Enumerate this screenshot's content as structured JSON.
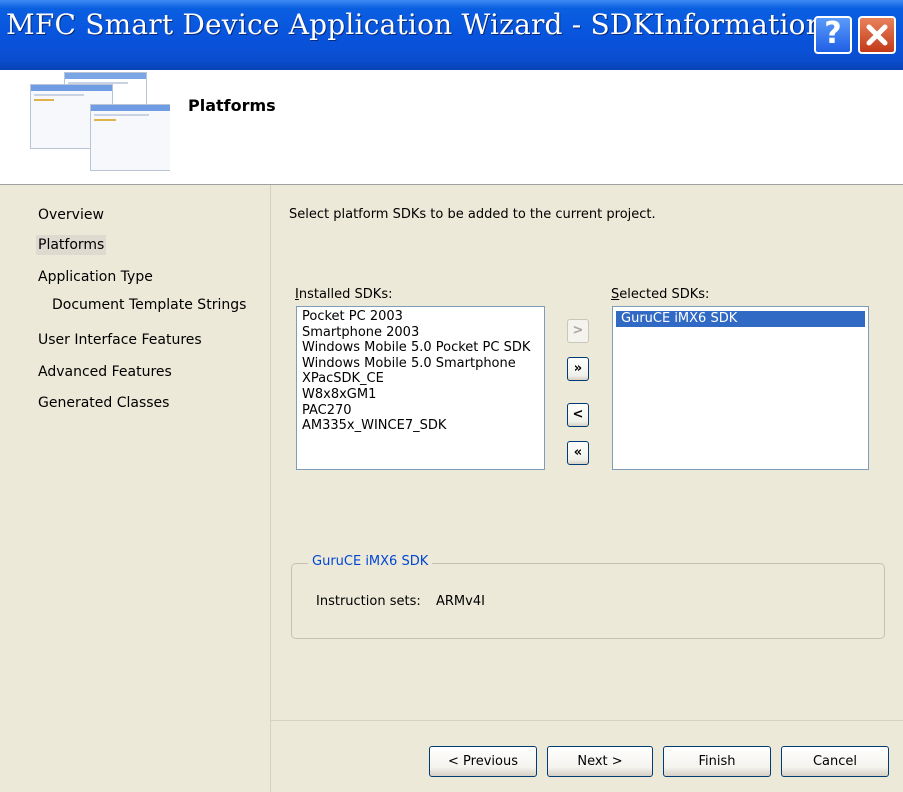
{
  "window": {
    "title": "MFC Smart Device Application Wizard - SDKInformation",
    "help_glyph": "?"
  },
  "header": {
    "title": "Platforms"
  },
  "nav": {
    "items": [
      {
        "label": "Overview"
      },
      {
        "label": "Platforms"
      },
      {
        "label": "Application Type"
      },
      {
        "label": "Document Template Strings"
      },
      {
        "label": "User Interface Features"
      },
      {
        "label": "Advanced Features"
      },
      {
        "label": "Generated Classes"
      }
    ],
    "active": "Platforms"
  },
  "main": {
    "instruction": "Select platform SDKs to be added to the current project.",
    "installed_label_first": "I",
    "installed_label_rest": "nstalled SDKs:",
    "selected_label_first": "S",
    "selected_label_rest": "elected SDKs:",
    "installed": [
      "Pocket PC 2003",
      "Smartphone 2003",
      "Windows Mobile 5.0 Pocket PC SDK",
      "Windows Mobile 5.0 Smartphone",
      "XPacSDK_CE",
      "W8x8xGM1",
      "PAC270",
      "AM335x_WINCE7_SDK"
    ],
    "selected": [
      "GuruCE iMX6 SDK"
    ],
    "move_buttons": {
      "add_one": ">",
      "add_all": "»",
      "remove_one": "<",
      "remove_all": "«"
    },
    "details": {
      "title": "GuruCE iMX6 SDK",
      "key": "Instruction sets:",
      "value": "ARMv4I"
    }
  },
  "footer": {
    "previous": "< Previous",
    "next": "Next >",
    "finish": "Finish",
    "cancel": "Cancel"
  },
  "colors": {
    "titlebar": "#0854dd",
    "selection": "#316ac5",
    "group_title": "#0046d5"
  }
}
